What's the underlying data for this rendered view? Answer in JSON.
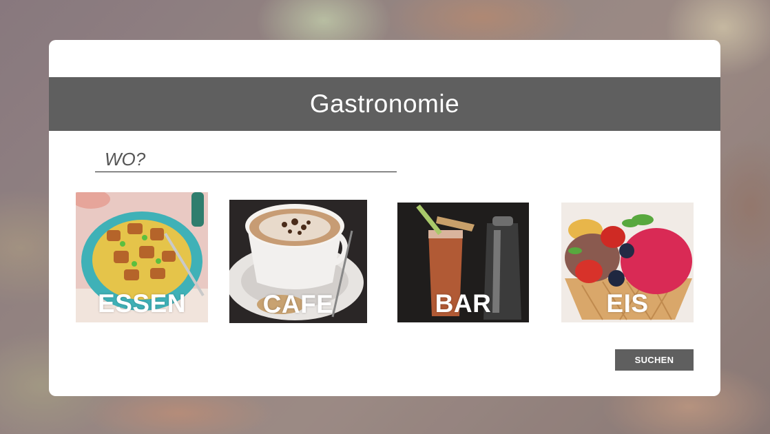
{
  "header": {
    "title": "Gastronomie"
  },
  "search": {
    "placeholder": "WO?"
  },
  "categories": [
    {
      "label": "ESSEN",
      "icon": "curry-dish-photo"
    },
    {
      "label": "CAFE",
      "icon": "cappuccino-photo"
    },
    {
      "label": "BAR",
      "icon": "cocktail-photo"
    },
    {
      "label": "EIS",
      "icon": "ice-cream-photo"
    }
  ],
  "actions": {
    "search_label": "SUCHEN"
  },
  "colors": {
    "bar": "#5f5f5f",
    "panel": "#ffffff"
  }
}
